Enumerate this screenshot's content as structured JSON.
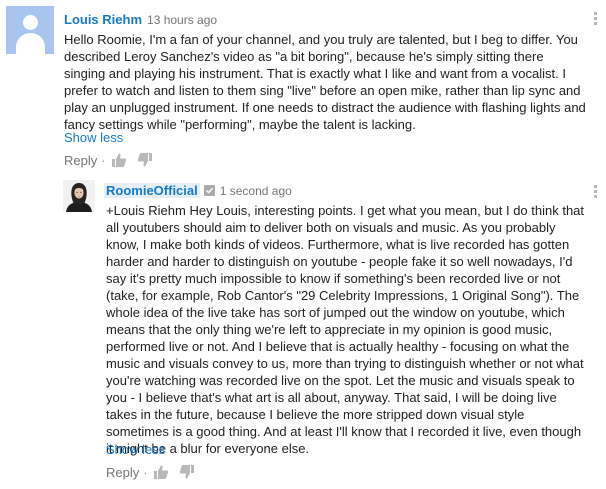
{
  "comments": [
    {
      "author": "Louis Riehm",
      "time": "13 hours ago",
      "text": "Hello Roomie, I'm a fan of your channel, and you truly are talented, but I beg to differ. You described Leroy Sanchez's video as \"a bit boring\", because he's simply sitting there singing and playing his instrument. That is exactly what I like and want from a vocalist. I prefer to watch and listen to them sing \"live\" before an open mike, rather than lip sync and play an unplugged instrument. If one needs to distract the audience with flashing lights and fancy settings while \"performing\", maybe the talent is lacking.",
      "show_less_label": "Show less",
      "reply_label": "Reply",
      "separator": "·",
      "avatar": "default-user-avatar"
    },
    {
      "author": "RoomieOfficial",
      "time": "1 second ago",
      "text": "+Louis Riehm Hey Louis, interesting points. I get what you mean, but I do think that all youtubers should aim to deliver both on visuals and music. As you probably know, I make both kinds of videos. Furthermore, what is live recorded has gotten harder and harder to distinguish on youtube - people fake it so well nowadays, I'd say it's pretty much impossible to know if something's been recorded live or not (take, for example, Rob Cantor's \"29 Celebrity Impressions, 1 Original Song\"). The whole idea of the live take has sort of jumped out the window on youtube, which means that the only thing we're left to appreciate in my opinion is good music, performed live or not. And I believe that is actually healthy - focusing on what the music and visuals convey to us, more than trying to distinguish whether or not what you're watching was recorded live on the spot. Let the music and visuals speak to you - I believe that's what art is all about, anyway. That said, I will be doing live takes in the future, because I believe the more stripped down visual style sometimes is a good thing. And at least I'll know that I recorded it live, even though it might be a blur for everyone else.",
      "show_less_label": "Show less",
      "reply_label": "Reply",
      "separator": "·",
      "avatar": "channel-owner-avatar",
      "badge_icon": "verified-check-icon"
    }
  ],
  "icons": {
    "like": "thumbs-up-icon",
    "dislike": "thumbs-down-icon",
    "menu": "more-vertical-icon"
  },
  "colors": {
    "link_blue": "#167ac6",
    "meta_gray": "#767676",
    "text": "#222222",
    "avatar_bg": "#a8c5f0"
  }
}
